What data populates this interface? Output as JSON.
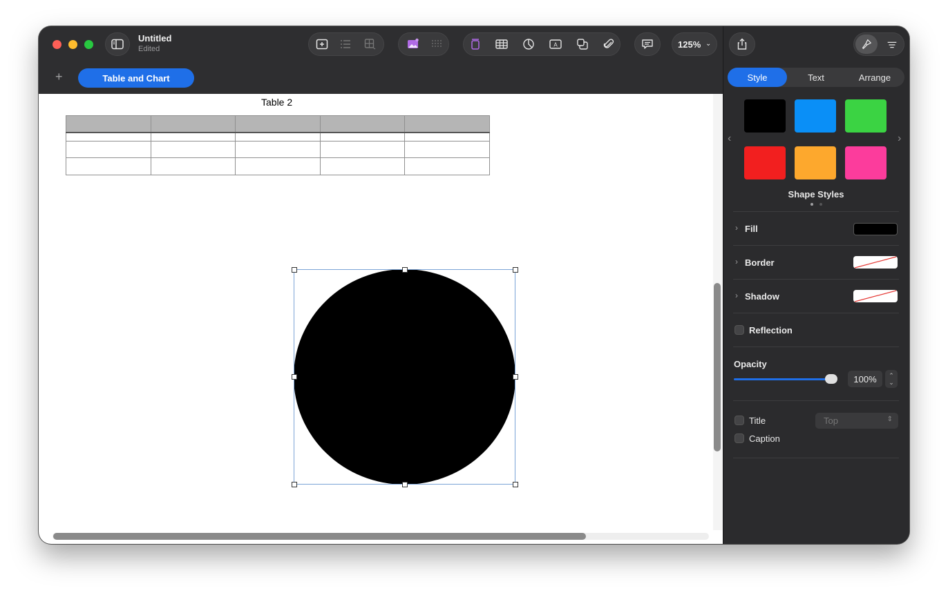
{
  "window": {
    "title": "Untitled",
    "subtitle": "Edited"
  },
  "toolbar": {
    "zoom": "125%",
    "icons": [
      "sidebar-icon",
      "add-page-icon",
      "list-icon",
      "table-rows-icon",
      "media-icon",
      "grid-icon",
      "text-box-icon",
      "table-icon",
      "chart-icon",
      "text-icon",
      "shape-icon",
      "attachment-icon",
      "comment-icon",
      "share-icon",
      "format-brush-icon",
      "document-icon"
    ]
  },
  "sheets": {
    "add_label": "+",
    "active_tab": "Table and Chart"
  },
  "canvas": {
    "table_title": "Table 2",
    "table": {
      "columns": 5,
      "rows": 4
    }
  },
  "inspector": {
    "tabs": [
      "Style",
      "Text",
      "Arrange"
    ],
    "active_tab": "Style",
    "swatches": [
      "#000000",
      "#0a8ff7",
      "#3bd343",
      "#f21f1f",
      "#fda82d",
      "#fc3c9c"
    ],
    "shape_styles_label": "Shape Styles",
    "fill_label": "Fill",
    "border_label": "Border",
    "shadow_label": "Shadow",
    "reflection_label": "Reflection",
    "opacity_label": "Opacity",
    "opacity_value": "100%",
    "opacity_level": 1.0,
    "title_label": "Title",
    "title_position": "Top",
    "caption_label": "Caption"
  }
}
